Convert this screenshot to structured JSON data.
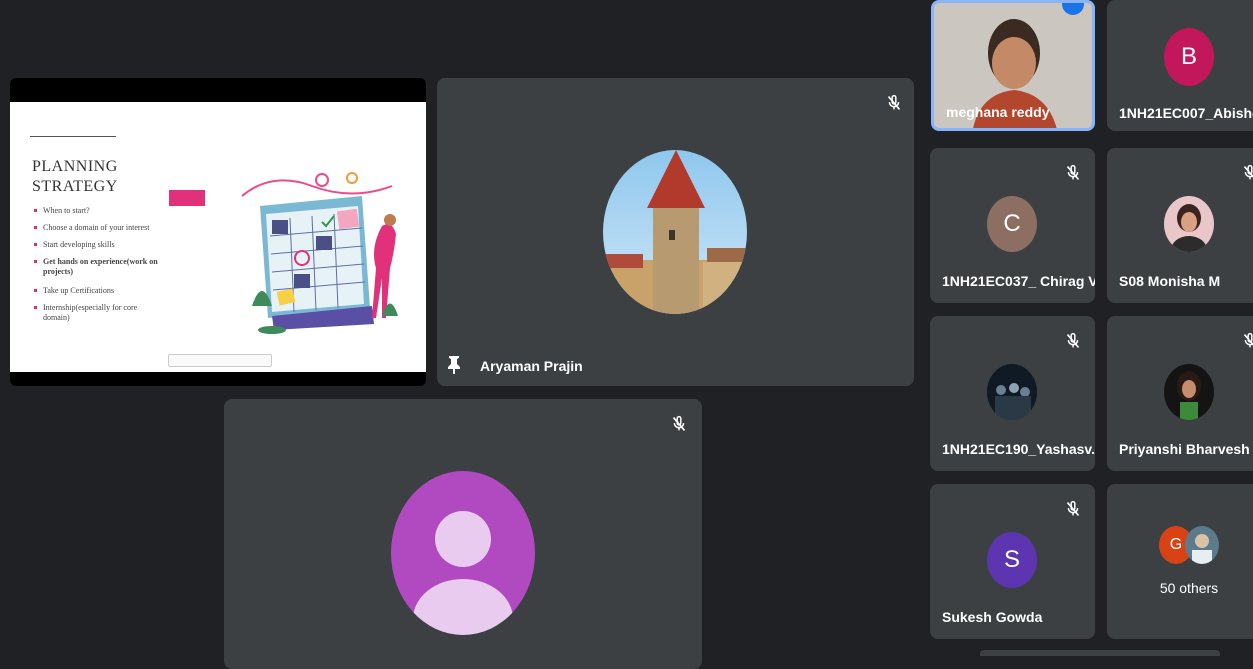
{
  "presentation": {
    "title_line1": "PLANNING",
    "title_line2": "STRATEGY",
    "bullets": [
      "When to start?",
      "Choose a domain of your interest",
      "Start developing skills",
      "Get hands on experience(work on projects)",
      "Take up Certifications",
      "Internship(especially for core domain)"
    ]
  },
  "main_tiles": {
    "aryaman": {
      "name": "Aryaman Prajin"
    },
    "bottom": {
      "name": ""
    }
  },
  "participants": [
    {
      "name": "meghana reddy",
      "avatar": "video",
      "muted": false
    },
    {
      "name": "1NH21EC007_Abishe...",
      "avatar_letter": "B",
      "color": "#c2185b"
    },
    {
      "name": "1NH21EC037_ Chirag V",
      "avatar_letter": "C",
      "color": "#8d6e63",
      "muted": true
    },
    {
      "name": "S08 Monisha M",
      "avatar": "photo",
      "muted": true
    },
    {
      "name": "1NH21EC190_Yashasv...",
      "avatar": "photo",
      "muted": true
    },
    {
      "name": "Priyanshi Bharvesh",
      "avatar": "photo",
      "muted": true
    },
    {
      "name": "Sukesh Gowda",
      "avatar_letter": "S",
      "color": "#5e35b1",
      "muted": true
    },
    {
      "name": "50 others",
      "avatar_letter": "G",
      "color": "#d84315"
    }
  ],
  "colors": {
    "background": "#202124",
    "tile": "#3c4043",
    "accent": "#1a73e8"
  }
}
